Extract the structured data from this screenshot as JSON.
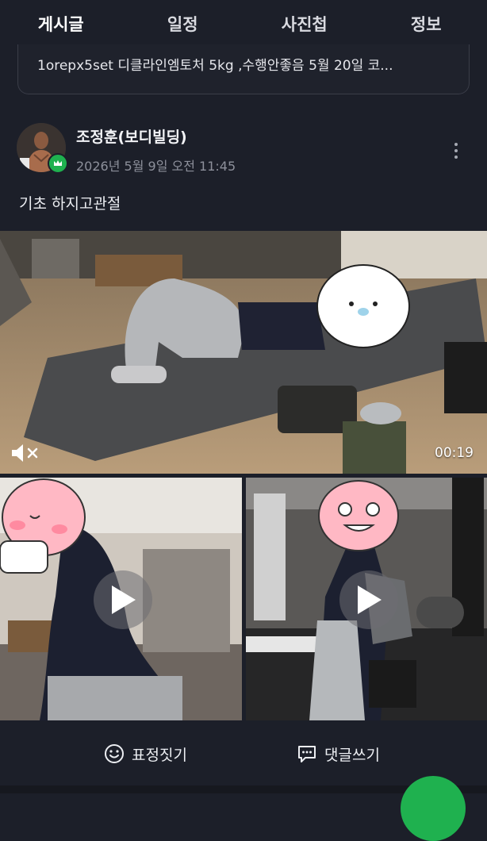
{
  "tabs": [
    {
      "label": "게시글",
      "active": true
    },
    {
      "label": "일정",
      "active": false
    },
    {
      "label": "사진첩",
      "active": false
    },
    {
      "label": "정보",
      "active": false
    }
  ],
  "previous_post": {
    "text": "1orepx5set 디클라인엠토처 5kg ,수행안좋음 5월 20일 코..."
  },
  "post": {
    "author": "조정훈(보디빌딩)",
    "time": "2026년 5월 9일 오전 11:45",
    "body": "기초 하지고관절",
    "main_video": {
      "duration": "00:19",
      "muted": true
    }
  },
  "actions": {
    "emoji_label": "표정짓기",
    "comment_label": "댓글쓰기"
  },
  "colors": {
    "background": "#1c1f29",
    "accent": "#1fb14f"
  }
}
